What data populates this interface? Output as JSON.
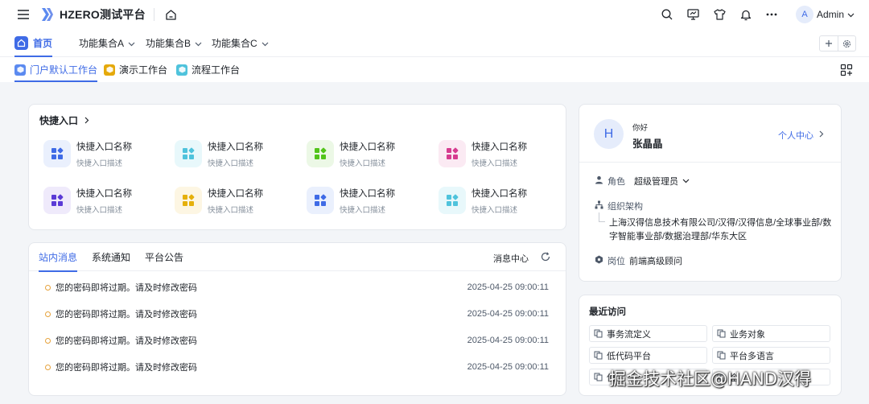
{
  "app": {
    "title": "HZERO测试平台"
  },
  "user": {
    "avatar_letter": "A",
    "name": "Admin"
  },
  "menu": {
    "items": [
      {
        "label": "首页",
        "active": true
      },
      {
        "label": "功能集合A"
      },
      {
        "label": "功能集合B"
      },
      {
        "label": "功能集合C"
      }
    ]
  },
  "workbench_tabs": [
    {
      "label": "门户默认工作台",
      "active": true,
      "color": "#5b8af0"
    },
    {
      "label": "演示工作台",
      "color": "#e5a90b"
    },
    {
      "label": "流程工作台",
      "color": "#4fc3dc"
    }
  ],
  "quick_entry": {
    "title": "快捷入口",
    "items": [
      {
        "name": "快捷入口名称",
        "desc": "快捷入口描述",
        "color": "#3f6be6",
        "bg": "#eaf0fd"
      },
      {
        "name": "快捷入口名称",
        "desc": "快捷入口描述",
        "color": "#4fc3dc",
        "bg": "#e8f8fb"
      },
      {
        "name": "快捷入口名称",
        "desc": "快捷入口描述",
        "color": "#52c41a",
        "bg": "#ecf8e6"
      },
      {
        "name": "快捷入口名称",
        "desc": "快捷入口描述",
        "color": "#d63b8f",
        "bg": "#fbeaf3"
      },
      {
        "name": "快捷入口名称",
        "desc": "快捷入口描述",
        "color": "#5b3bd6",
        "bg": "#efeafb"
      },
      {
        "name": "快捷入口名称",
        "desc": "快捷入口描述",
        "color": "#e5b00b",
        "bg": "#fdf6e3"
      },
      {
        "name": "快捷入口名称",
        "desc": "快捷入口描述",
        "color": "#3f6be6",
        "bg": "#eaf0fd"
      },
      {
        "name": "快捷入口名称",
        "desc": "快捷入口描述",
        "color": "#4fc3dc",
        "bg": "#e8f8fb"
      }
    ]
  },
  "messages": {
    "tabs": [
      {
        "label": "站内消息",
        "active": true
      },
      {
        "label": "系统通知"
      },
      {
        "label": "平台公告"
      }
    ],
    "center_label": "消息中心",
    "rows": [
      {
        "text": "您的密码即将过期。请及时修改密码",
        "time": "2025-04-25 09:00:11"
      },
      {
        "text": "您的密码即将过期。请及时修改密码",
        "time": "2025-04-25 09:00:11"
      },
      {
        "text": "您的密码即将过期。请及时修改密码",
        "time": "2025-04-25 09:00:11"
      },
      {
        "text": "您的密码即将过期。请及时修改密码",
        "time": "2025-04-25 09:00:11"
      }
    ]
  },
  "profile": {
    "avatar_letter": "H",
    "greeting": "你好",
    "name": "张晶晶",
    "personal_center": "个人中心",
    "role_label": "角色",
    "role_value": "超级管理员",
    "org_label": "组织架构",
    "org_path": "上海汉得信息技术有限公司/汉得/汉得信息/全球事业部/数字智能事业部/数据治理部/华东大区",
    "post_label": "岗位",
    "post_value": "前端高级顾问"
  },
  "recent": {
    "title": "最近访问",
    "items": [
      "事务流定义",
      "业务对象",
      "低代码平台",
      "平台多语言",
      "使",
      "企"
    ]
  },
  "watermark": "掘金技术社区@HAND汉得"
}
